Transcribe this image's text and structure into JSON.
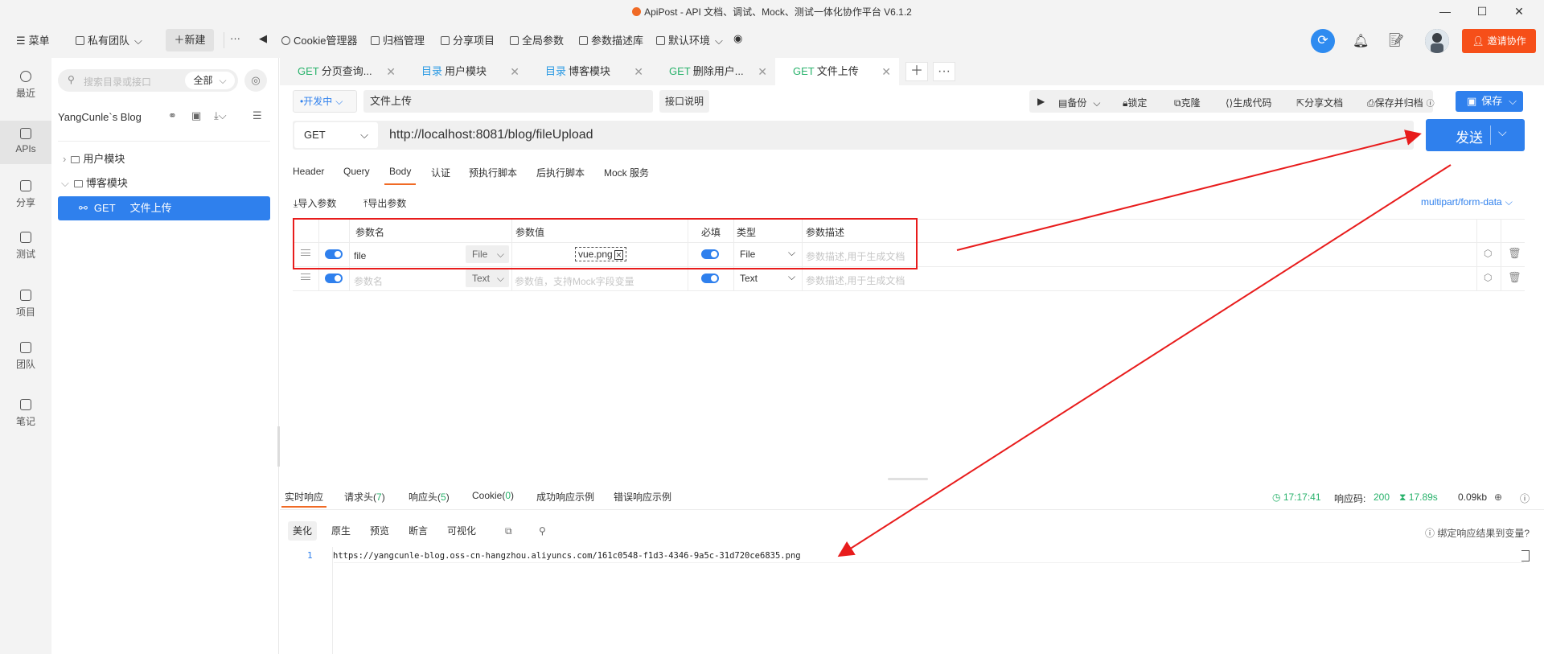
{
  "window": {
    "title": "ApiPost - API 文档、调试、Mock、测试一体化协作平台 V6.1.2",
    "minimize": "—",
    "maximize": "☐",
    "close": "✕"
  },
  "toolbar": {
    "menu": "菜单",
    "team": "私有团队",
    "new": "新建",
    "more": "···",
    "items": [
      "Cookie管理器",
      "归档管理",
      "分享项目",
      "全局参数",
      "参数描述库",
      "默认环境"
    ],
    "invite": "邀请协作"
  },
  "leftnav": [
    "最近",
    "APIs",
    "分享",
    "测试",
    "项目",
    "团队",
    "笔记"
  ],
  "sidebar": {
    "search_placeholder": "搜索目录或接口",
    "filter": "全部",
    "project": "YangCunle`s Blog",
    "tree": [
      {
        "label": "用户模块",
        "type": "folder"
      },
      {
        "label": "博客模块",
        "type": "folder"
      },
      {
        "method": "GET",
        "label": "文件上传",
        "type": "api"
      }
    ]
  },
  "tabs": [
    {
      "method": "GET",
      "label": "分页查询..."
    },
    {
      "method": "目录",
      "label": "用户模块"
    },
    {
      "method": "目录",
      "label": "博客模块"
    },
    {
      "method": "GET",
      "label": "删除用户..."
    },
    {
      "method": "GET",
      "label": "文件上传"
    }
  ],
  "request": {
    "status": "开发中",
    "name": "文件上传",
    "doc_button": "接口说明",
    "actions": [
      "备份",
      "锁定",
      "克隆",
      "生成代码",
      "分享文档",
      "保存并归档"
    ],
    "save": "保存",
    "method": "GET",
    "url": "http://localhost:8081/blog/fileUpload",
    "send": "发送"
  },
  "subtabs": [
    "Header",
    "Query",
    "Body",
    "认证",
    "预执行脚本",
    "后执行脚本",
    "Mock 服务"
  ],
  "body": {
    "import": "导入参数",
    "export": "导出参数",
    "content_type": "multipart/form-data",
    "headers": [
      "参数名",
      "参数值",
      "必填",
      "类型",
      "参数描述"
    ],
    "rows": [
      {
        "name": "file",
        "kind": "File",
        "value": "vue.png",
        "type": "File",
        "desc_placeholder": "参数描述,用于生成文档"
      },
      {
        "name_placeholder": "参数名",
        "kind": "Text",
        "value_placeholder": "参数值，支持Mock字段变量",
        "type": "Text",
        "desc_placeholder": "参数描述,用于生成文档"
      }
    ]
  },
  "response": {
    "tabs": [
      {
        "label": "实时响应"
      },
      {
        "label": "请求头",
        "count": "7"
      },
      {
        "label": "响应头",
        "count": "5"
      },
      {
        "label": "Cookie",
        "count": "0"
      },
      {
        "label": "成功响应示例"
      },
      {
        "label": "错误响应示例"
      }
    ],
    "time": "17:17:41",
    "code_label": "响应码:",
    "code": "200",
    "duration": "17.89s",
    "size": "0.09kb",
    "views": [
      "美化",
      "原生",
      "预览",
      "断言",
      "可视化"
    ],
    "bind_var": "绑定响应结果到变量?",
    "line_no": "1",
    "body": "https://yangcunle-blog.oss-cn-hangzhou.aliyuncs.com/161c0548-f1d3-4346-9a5c-31d720ce6835.png"
  },
  "colors": {
    "accent": "#2f80ed",
    "orange": "#f06a25",
    "green": "#28b26b",
    "annotation_red": "#e81c1c"
  }
}
